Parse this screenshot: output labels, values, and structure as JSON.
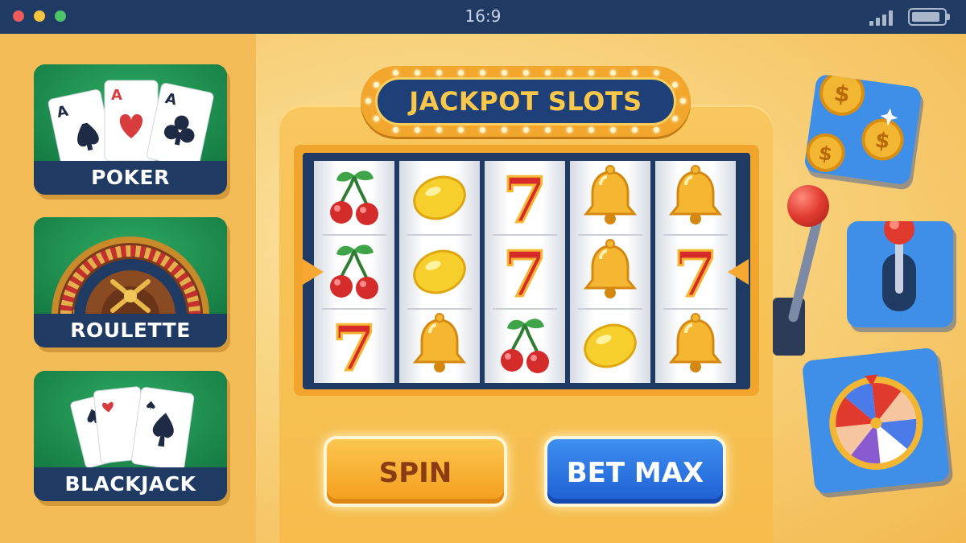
{
  "window": {
    "title": "16:9"
  },
  "games": [
    {
      "label": "POKER"
    },
    {
      "label": "ROULETTE"
    },
    {
      "label": "BLACKJACK"
    }
  ],
  "marquee": {
    "title": "JACKPOT SLOTS"
  },
  "reels": [
    [
      "cherry",
      "cherry",
      "seven"
    ],
    [
      "lemon",
      "lemon",
      "bell"
    ],
    [
      "seven",
      "seven",
      "cherry"
    ],
    [
      "bell",
      "bell",
      "lemon"
    ],
    [
      "bell",
      "seven",
      "bell"
    ]
  ],
  "buttons": {
    "spin": "SPIN",
    "bet_max": "BET MAX"
  },
  "side_tiles": [
    {
      "icon": "coins-icon"
    },
    {
      "icon": "joystick-icon"
    },
    {
      "icon": "prize-wheel-icon"
    }
  ],
  "colors": {
    "topbar": "#1f3a63",
    "background": "#f5c45a",
    "card_felt": "#1f8a4e",
    "spin": "#f49d1c",
    "bet_max": "#1e5ed3",
    "tile_blue": "#3f8ee8"
  }
}
